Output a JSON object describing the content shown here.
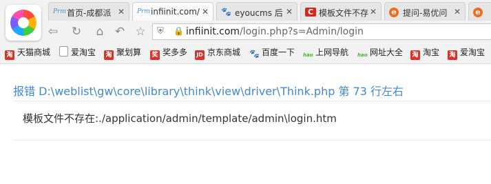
{
  "tabs": [
    {
      "favicon": "Prm",
      "title": "首页-成都派",
      "close": "✕"
    },
    {
      "favicon": "Prm",
      "title": "infiinit.com/",
      "close": "✕"
    },
    {
      "favicon": "paw",
      "title": "eyoucms 后",
      "close": "✕"
    },
    {
      "favicon": "C",
      "title": "模板文件不存",
      "close": "✕"
    },
    {
      "favicon": "e",
      "title": "提问-易优问",
      "close": "✕"
    },
    {
      "favicon": "e",
      "title": "",
      "close": ""
    }
  ],
  "address": {
    "host": "infiinit.com",
    "path": "/login.php?s=Admin/login"
  },
  "bookmarks": [
    {
      "icon": "淘",
      "label": "天猫商城",
      "color": "#d8322a"
    },
    {
      "icon": "▯",
      "label": "爱淘宝",
      "color": "#ffffff"
    },
    {
      "icon": "淘",
      "label": "聚划算",
      "color": "#d8322a"
    },
    {
      "icon": "奖",
      "label": "奖多多",
      "color": "#d8322a"
    },
    {
      "icon": "JD",
      "label": "京东商城",
      "color": "#d8322a"
    },
    {
      "icon": "paw",
      "label": "百度一下",
      "color": "#2d7be0"
    },
    {
      "icon": "hao",
      "label": "上网导航",
      "color": "#4caf3a"
    },
    {
      "icon": "hao",
      "label": "网址大全",
      "color": "#4caf3a"
    },
    {
      "icon": "淘",
      "label": "淘宝",
      "color": "#d8322a"
    },
    {
      "icon": "淘",
      "label": "爱淘宝",
      "color": "#d8322a"
    }
  ],
  "error": {
    "title": "报错 D:\\weblist\\gw\\core\\library\\think\\view\\driver\\Think.php 第 73 行左右",
    "message": "模板文件不存在:./application/admin/template/admin\\login.htm"
  }
}
